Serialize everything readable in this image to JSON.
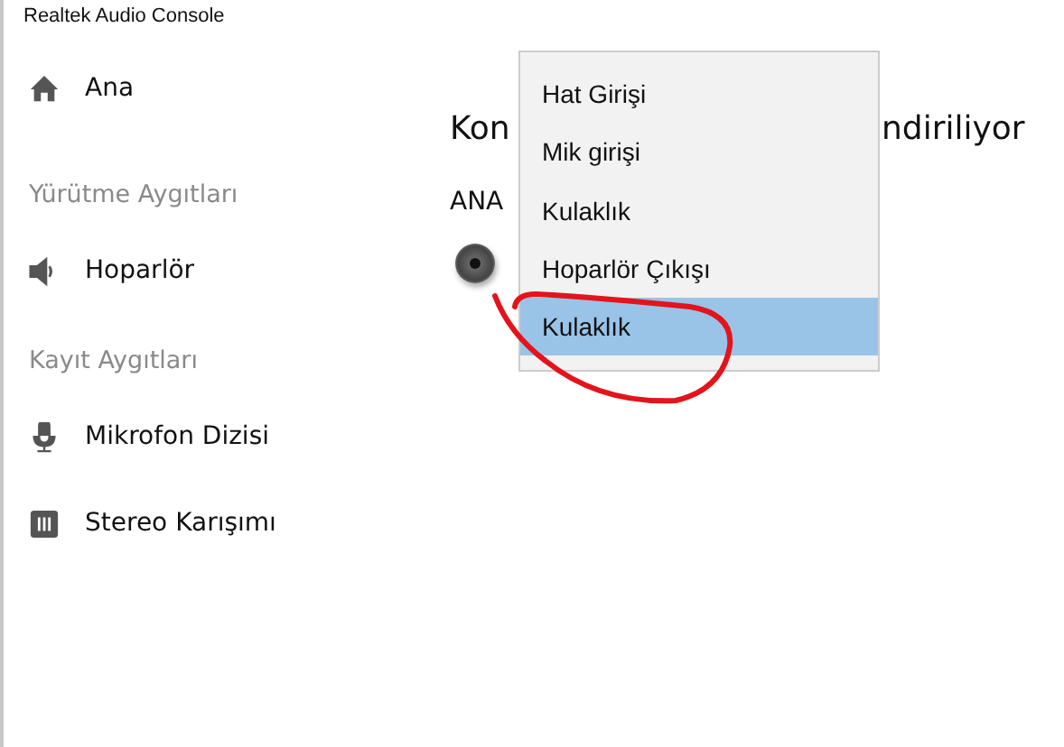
{
  "window": {
    "title": "Realtek Audio Console"
  },
  "sidebar": {
    "items": [
      {
        "kind": "item",
        "label": "Ana"
      },
      {
        "kind": "header",
        "label": "Yürütme Aygıtları"
      },
      {
        "kind": "item",
        "label": "Hoparlör"
      },
      {
        "kind": "header",
        "label": "Kayıt Aygıtları"
      },
      {
        "kind": "item",
        "label": "Mikrofon Dizisi"
      },
      {
        "kind": "item",
        "label": "Stereo Karışımı"
      }
    ]
  },
  "main": {
    "heading_fragments": [
      "Kon",
      "ndiriliyor"
    ],
    "connector_label": "ANA"
  },
  "dropdown": {
    "options": [
      {
        "label": "Hat Girişi",
        "selected": false
      },
      {
        "label": "Mik girişi",
        "selected": false
      },
      {
        "label": "Kulaklık",
        "selected": false
      },
      {
        "label": "Hoparlör Çıkışı",
        "selected": false
      },
      {
        "label": "Kulaklık",
        "selected": true
      }
    ]
  }
}
